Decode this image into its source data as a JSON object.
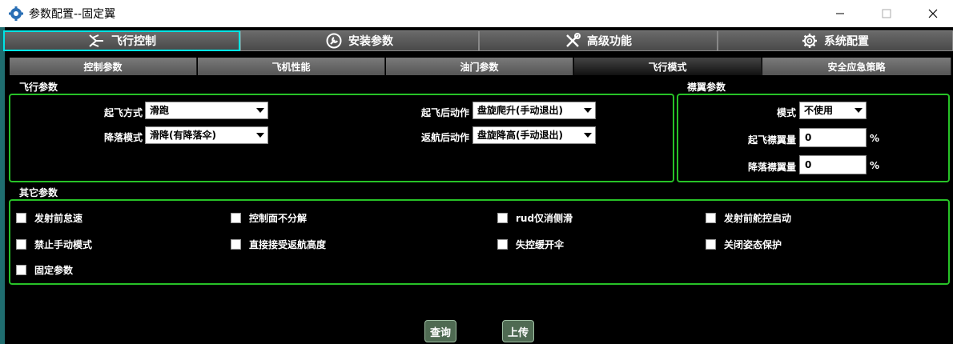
{
  "window": {
    "title": "参数配置--固定翼"
  },
  "main_tabs": [
    {
      "label": "飞行控制",
      "icon": "plane-icon",
      "active": true
    },
    {
      "label": "安装参数",
      "icon": "wrench-circle-icon",
      "active": false
    },
    {
      "label": "高级功能",
      "icon": "tools-icon",
      "active": false
    },
    {
      "label": "系统配置",
      "icon": "gear-icon",
      "active": false
    }
  ],
  "sub_tabs": [
    {
      "label": "控制参数",
      "active": false
    },
    {
      "label": "飞机性能",
      "active": false
    },
    {
      "label": "油门参数",
      "active": false
    },
    {
      "label": "飞行模式",
      "active": true
    },
    {
      "label": "安全应急策略",
      "active": false
    }
  ],
  "flight_params": {
    "section": "飞行参数",
    "takeoff_mode": {
      "label": "起飞方式",
      "value": "滑跑"
    },
    "landing_mode": {
      "label": "降落模式",
      "value": "滑降(有降落伞)"
    },
    "post_takeoff": {
      "label": "起飞后动作",
      "value": "盘旋爬升(手动退出)"
    },
    "post_return": {
      "label": "返航后动作",
      "value": "盘旋降高(手动退出)"
    }
  },
  "flap_params": {
    "section": "襟翼参数",
    "mode": {
      "label": "模式",
      "value": "不使用"
    },
    "takeoff_flap": {
      "label": "起飞襟翼量",
      "value": "0",
      "unit": "%"
    },
    "landing_flap": {
      "label": "降落襟翼量",
      "value": "0",
      "unit": "%"
    }
  },
  "other_params": {
    "section": "其它参数",
    "checkboxes": [
      {
        "label": "发射前怠速",
        "checked": false
      },
      {
        "label": "控制面不分解",
        "checked": false
      },
      {
        "label": "rud仅消侧滑",
        "checked": false
      },
      {
        "label": "发射前舵控启动",
        "checked": false
      },
      {
        "label": "禁止手动模式",
        "checked": false
      },
      {
        "label": "直接接受返航高度",
        "checked": false
      },
      {
        "label": "失控缓开伞",
        "checked": false
      },
      {
        "label": "关闭姿态保护",
        "checked": false
      },
      {
        "label": "固定参数",
        "checked": false
      }
    ]
  },
  "actions": {
    "query": "查询",
    "upload": "上传"
  },
  "colors": {
    "accent_border": "#27c227",
    "active_tab_border": "#00e5e5",
    "button_bg": "#4f6a52"
  }
}
